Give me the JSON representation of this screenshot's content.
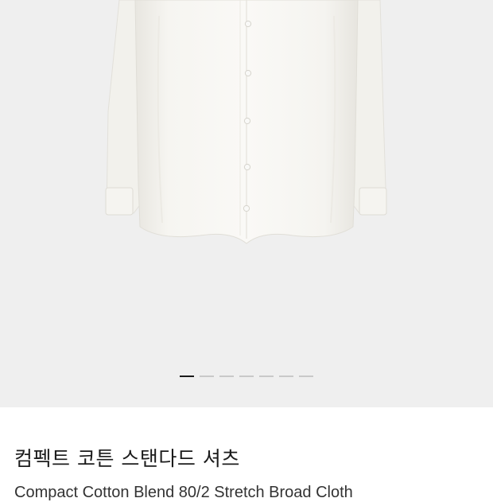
{
  "gallery": {
    "background": "#efefef",
    "image": {
      "subject": "white-button-down-shirt",
      "alt": ""
    },
    "pager": {
      "count": 7,
      "active_index": 0
    }
  },
  "product": {
    "name_ko": "컴펙트 코튼 스탠다드 셔츠",
    "name_en": "Compact Cotton Blend 80/2 Stretch Broad Cloth"
  },
  "colors": {
    "page_bg": "#ffffff",
    "gallery_bg": "#efefef",
    "indicator_active": "#1a1a1a",
    "indicator_inactive": "#c9c9c9",
    "text": "#1b1b1b"
  }
}
